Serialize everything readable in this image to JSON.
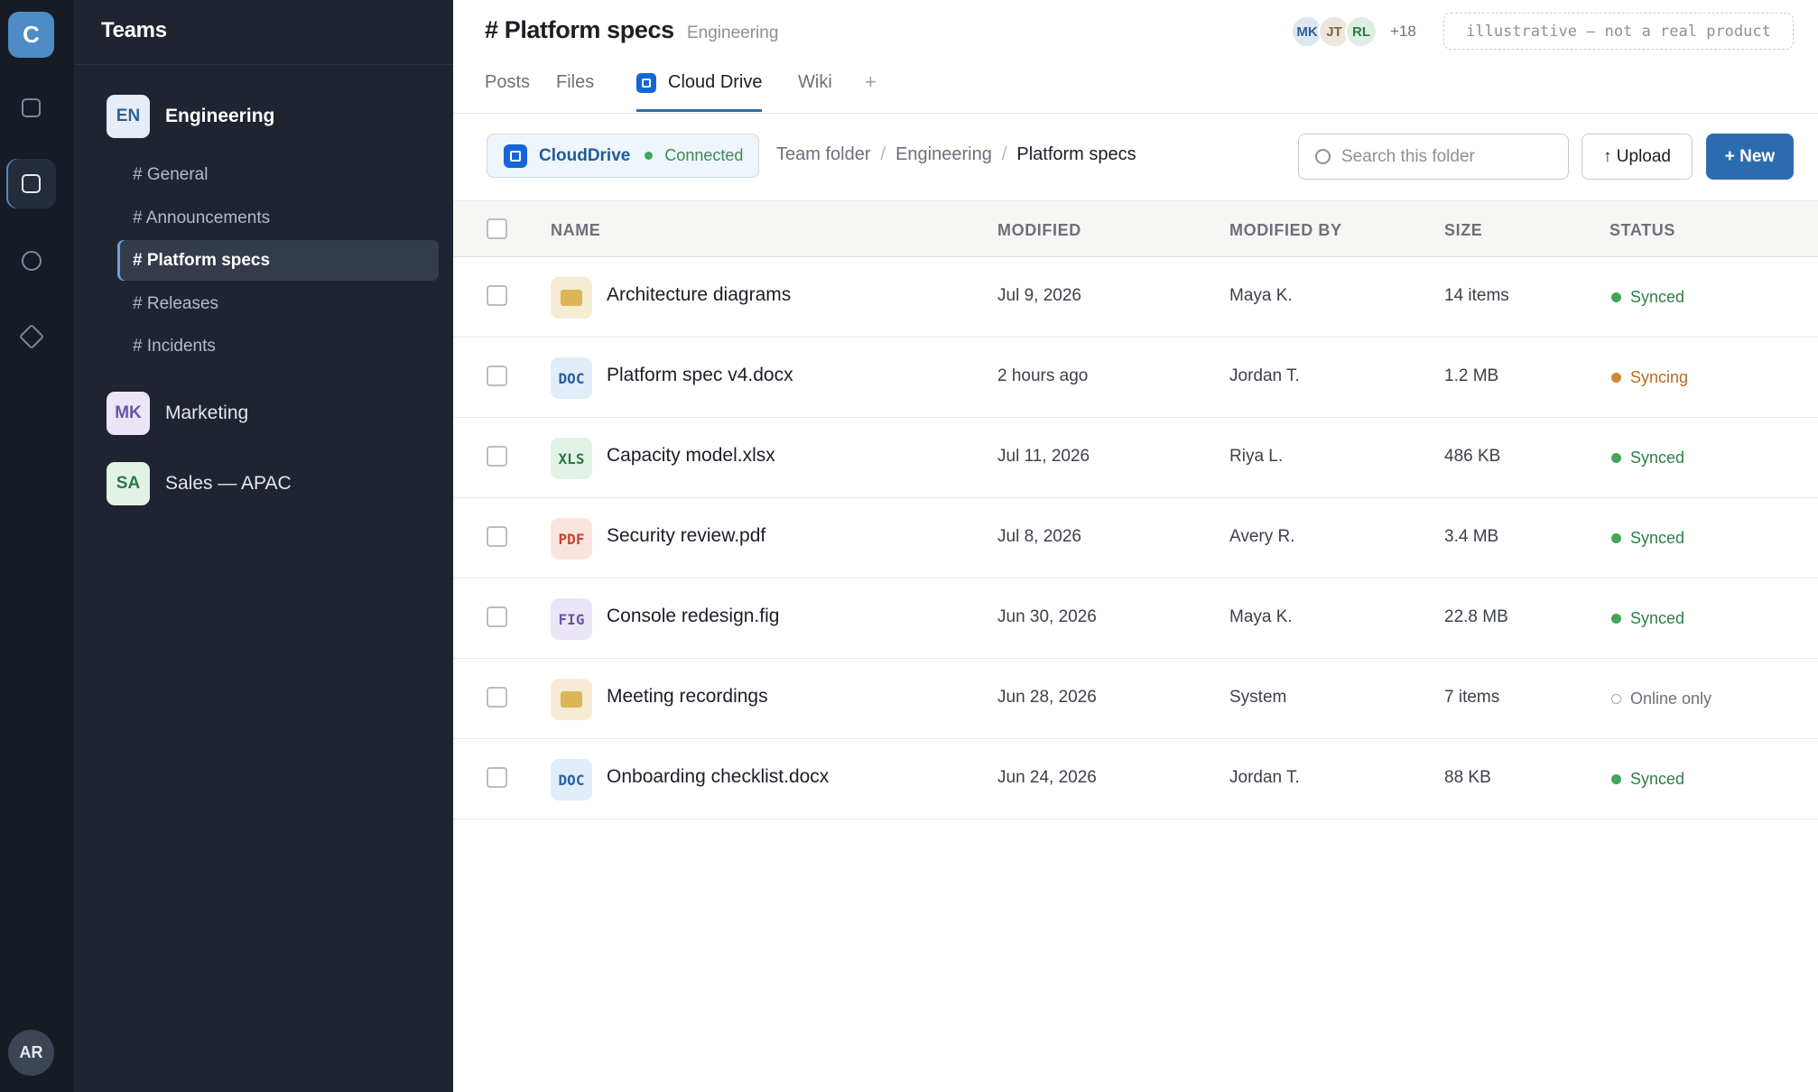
{
  "rail": {
    "logo": "C",
    "items": [
      {
        "name": "rail-item-1",
        "icon": "square-icon",
        "active": false
      },
      {
        "name": "rail-item-teams",
        "icon": "square-icon",
        "active": true
      },
      {
        "name": "rail-item-3",
        "icon": "circle-icon",
        "active": false
      },
      {
        "name": "rail-item-4",
        "icon": "diamond-icon",
        "active": false
      }
    ],
    "user_initials": "AR"
  },
  "sidebar": {
    "title": "Teams",
    "teams": [
      {
        "initials": "EN",
        "name": "Engineering",
        "badge_bg": "#e6edf6",
        "badge_fg": "#2f5e93",
        "expanded": true
      },
      {
        "initials": "MK",
        "name": "Marketing",
        "badge_bg": "#ebe6f6",
        "badge_fg": "#6a54a8",
        "expanded": false
      },
      {
        "initials": "SA",
        "name": "Sales — APAC",
        "badge_bg": "#e2f2e6",
        "badge_fg": "#2a7a45",
        "expanded": false
      }
    ],
    "channels": [
      "# General",
      "# Announcements",
      "# Platform specs",
      "# Releases",
      "# Incidents"
    ],
    "active_channel": "# Platform specs"
  },
  "header": {
    "title": "# Platform specs",
    "subtitle": "Engineering",
    "avatars": [
      {
        "initials": "MK",
        "bg": "#dde7f2",
        "fg": "#2f5e93"
      },
      {
        "initials": "JT",
        "bg": "#ece6dc",
        "fg": "#7a6443"
      },
      {
        "initials": "RL",
        "bg": "#dfeee2",
        "fg": "#2a7a45"
      }
    ],
    "member_more": "+18",
    "disclaimer": "illustrative — not a real product",
    "tabs": [
      "Posts",
      "Files",
      "Cloud Drive",
      "Wiki"
    ],
    "active_tab": "Cloud Drive",
    "add_tab": "+"
  },
  "toolbar": {
    "connection_name": "CloudDrive",
    "connection_status": "Connected",
    "breadcrumb": [
      "Team folder",
      "Engineering",
      "Platform specs"
    ],
    "search_placeholder": "Search this folder",
    "upload_label": "↑ Upload",
    "new_label": "+ New"
  },
  "table": {
    "columns": [
      "NAME",
      "MODIFIED",
      "MODIFIED BY",
      "SIZE",
      "STATUS"
    ],
    "rows": [
      {
        "type": "folder",
        "name": "Architecture diagrams",
        "modified": "Jul 9, 2026",
        "by": "Maya K.",
        "size": "14 items",
        "status": "Synced"
      },
      {
        "type": "doc",
        "label": "DOC",
        "name": "Platform spec v4.docx",
        "modified": "2 hours ago",
        "by": "Jordan T.",
        "size": "1.2 MB",
        "status": "Syncing"
      },
      {
        "type": "xls",
        "label": "XLS",
        "name": "Capacity model.xlsx",
        "modified": "Jul 11, 2026",
        "by": "Riya L.",
        "size": "486 KB",
        "status": "Synced"
      },
      {
        "type": "pdf",
        "label": "PDF",
        "name": "Security review.pdf",
        "modified": "Jul 8, 2026",
        "by": "Avery R.",
        "size": "3.4 MB",
        "status": "Synced"
      },
      {
        "type": "fig",
        "label": "FIG",
        "name": "Console redesign.fig",
        "modified": "Jun 30, 2026",
        "by": "Maya K.",
        "size": "22.8 MB",
        "status": "Synced"
      },
      {
        "type": "folder",
        "name": "Meeting recordings",
        "modified": "Jun 28, 2026",
        "by": "System",
        "size": "7 items",
        "status": "Online only"
      },
      {
        "type": "doc",
        "label": "DOC",
        "name": "Onboarding checklist.docx",
        "modified": "Jun 24, 2026",
        "by": "Jordan T.",
        "size": "88 KB",
        "status": "Synced"
      }
    ],
    "status_colors": {
      "Synced": "#3fa65c",
      "Syncing": "#d0843c",
      "Online only": "#a3a8b0"
    },
    "status_text_colors": {
      "Synced": "#2f7d48",
      "Syncing": "#b86a24",
      "Online only": "#6b717b"
    }
  }
}
